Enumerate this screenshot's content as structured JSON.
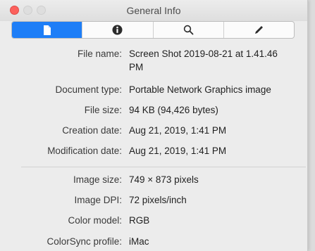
{
  "window": {
    "title": "General Info"
  },
  "toolbar": {
    "tabs": [
      {
        "name": "general",
        "icon": "document-icon",
        "active": true
      },
      {
        "name": "info",
        "icon": "info-icon",
        "active": false
      },
      {
        "name": "search",
        "icon": "magnifier-icon",
        "active": false
      },
      {
        "name": "annotate",
        "icon": "pen-icon",
        "active": false
      }
    ],
    "accent": "#1e7ef7"
  },
  "file_info": {
    "file_name_label": "File name:",
    "file_name_line1": "Screen Shot 2019-08-21 at 1.41.46",
    "file_name_line2": "PM",
    "document_type_label": "Document type:",
    "document_type": "Portable Network Graphics image",
    "file_size_label": "File size:",
    "file_size": "94 KB (94,426 bytes)",
    "creation_date_label": "Creation date:",
    "creation_date": "Aug 21, 2019, 1:41 PM",
    "modification_date_label": "Modification date:",
    "modification_date": "Aug 21, 2019, 1:41 PM"
  },
  "image_info": {
    "image_size_label": "Image size:",
    "image_size": "749 × 873 pixels",
    "image_dpi_label": "Image DPI:",
    "image_dpi": "72 pixels/inch",
    "color_model_label": "Color model:",
    "color_model": "RGB",
    "colorsync_profile_label": "ColorSync profile:",
    "colorsync_profile": "iMac"
  }
}
